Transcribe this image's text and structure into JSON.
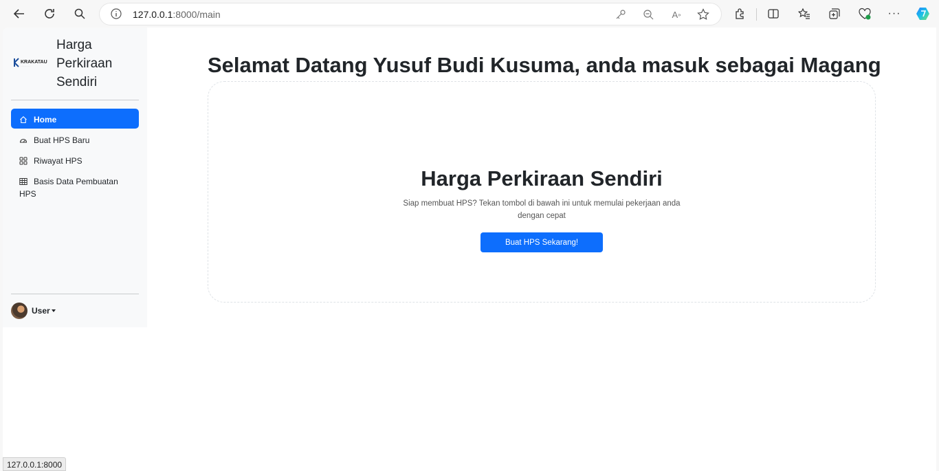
{
  "browser": {
    "url_host": "127.0.0.1",
    "url_rest": ":8000/main",
    "status_url": "127.0.0.1:8000"
  },
  "sidebar": {
    "brand_logo_text": "KRAKATAU",
    "brand_title": "Harga Perkiraan Sendiri",
    "items": [
      {
        "label": "Home",
        "icon": "home-icon",
        "active": true
      },
      {
        "label": "Buat HPS Baru",
        "icon": "speedometer-icon",
        "active": false
      },
      {
        "label": "Riwayat HPS",
        "icon": "grid-icon",
        "active": false
      },
      {
        "label": "Basis Data Pembuatan HPS",
        "icon": "table-icon",
        "active": false
      }
    ],
    "user_label": "User"
  },
  "main": {
    "welcome": "Selamat Datang Yusuf Budi Kusuma, anda masuk sebagai Magang",
    "card_title": "Harga Perkiraan Sendiri",
    "card_desc": "Siap membuat HPS? Tekan tombol di bawah ini untuk memulai pekerjaan anda dengan cepat",
    "card_button": "Buat HPS Sekarang!"
  },
  "colors": {
    "primary": "#0d6efd",
    "sidebar_bg": "#f8f9fa",
    "text": "#212529"
  }
}
